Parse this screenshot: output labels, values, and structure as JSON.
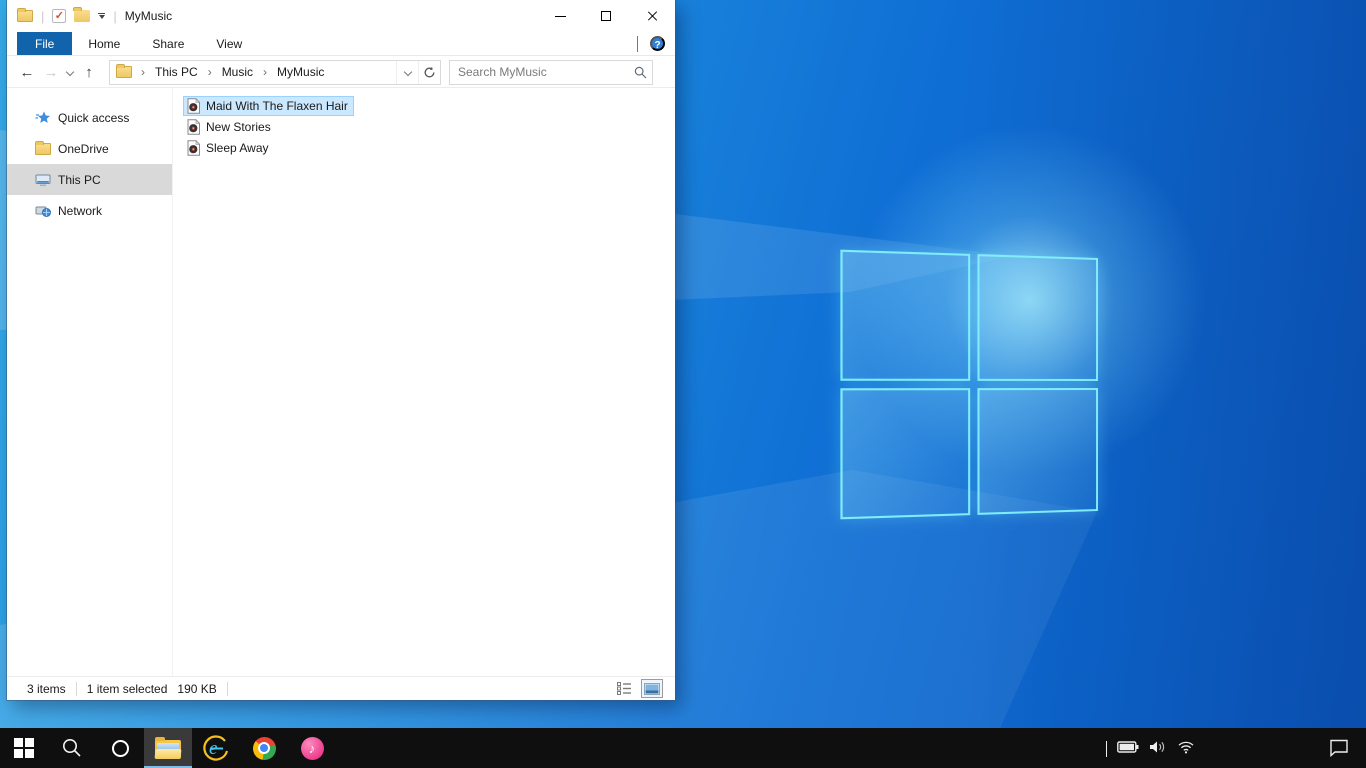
{
  "colors": {
    "accent_blue": "#1164ac",
    "file_selection_bg": "#cce8ff",
    "file_selection_border": "#99d1ff",
    "sidebar_selected_bg": "#d9d9d9",
    "taskbar_bg": "#0f0f0f",
    "taskbar_active_underline": "#7fbde9",
    "wallpaper_light": "#35abe8",
    "wallpaper_dark": "#0b5ac0",
    "help_icon_bg": "#2f7fd6"
  },
  "titlebar": {
    "title": "MyMusic",
    "qat_icons": [
      "window-folder-icon",
      "properties-check-icon",
      "new-folder-icon",
      "customize-qat-dropdown"
    ],
    "window_controls": [
      "minimize",
      "maximize",
      "close"
    ]
  },
  "ribbon": {
    "tabs": [
      {
        "label": "File",
        "active": true
      },
      {
        "label": "Home",
        "active": false
      },
      {
        "label": "Share",
        "active": false
      },
      {
        "label": "View",
        "active": false
      }
    ],
    "help_label": "?"
  },
  "navbar": {
    "breadcrumb": [
      "This PC",
      "Music",
      "MyMusic"
    ],
    "search_placeholder": "Search MyMusic"
  },
  "sidebar": {
    "items": [
      {
        "label": "Quick access",
        "icon": "star-icon",
        "selected": false
      },
      {
        "label": "OneDrive",
        "icon": "folder-icon",
        "selected": false
      },
      {
        "label": "This PC",
        "icon": "monitor-icon",
        "selected": true
      },
      {
        "label": "Network",
        "icon": "network-icon",
        "selected": false
      }
    ]
  },
  "files": {
    "items": [
      {
        "name": "Maid With The Flaxen Hair",
        "icon": "audio-file-icon",
        "selected": true
      },
      {
        "name": "New Stories",
        "icon": "audio-file-icon",
        "selected": false
      },
      {
        "name": "Sleep Away",
        "icon": "audio-file-icon",
        "selected": false
      }
    ]
  },
  "statusbar": {
    "item_count": "3 items",
    "selection": "1 item selected",
    "selection_size": "190 KB",
    "views": [
      "details-view",
      "thumbnail-view"
    ]
  },
  "taskbar": {
    "apps": [
      {
        "name": "start",
        "active": false
      },
      {
        "name": "search",
        "active": false
      },
      {
        "name": "cortana",
        "active": false
      },
      {
        "name": "file-explorer",
        "active": true
      },
      {
        "name": "internet-explorer",
        "active": false
      },
      {
        "name": "chrome",
        "active": false
      },
      {
        "name": "itunes",
        "active": false
      }
    ],
    "tray_icons": [
      "tray-expand",
      "battery",
      "volume",
      "network-wifi"
    ],
    "action_center": "action-center"
  }
}
